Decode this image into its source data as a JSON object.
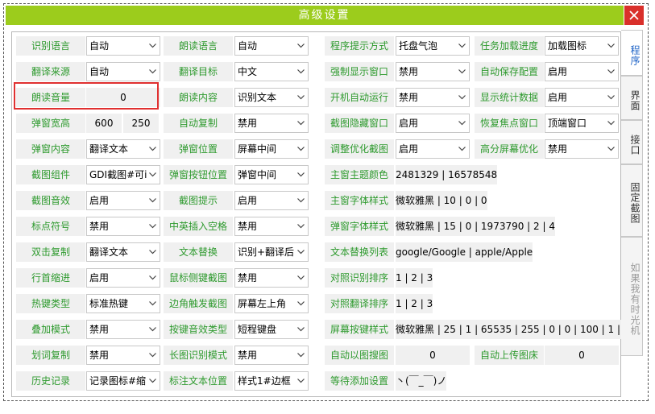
{
  "window": {
    "title": "高级设置"
  },
  "tabs": [
    {
      "label": "程序",
      "state": "active"
    },
    {
      "label": "界面",
      "state": "normal"
    },
    {
      "label": "接口",
      "state": "normal"
    },
    {
      "label": "固定截图",
      "state": "normal"
    },
    {
      "label": "如果我有时光机",
      "state": "dim"
    }
  ],
  "rows": [
    [
      [
        "l",
        "识别语言"
      ],
      [
        "d",
        "自动"
      ],
      [
        "l",
        "朗读语言"
      ],
      [
        "d",
        "自动"
      ],
      [
        "l",
        "程序提示方式"
      ],
      [
        "d",
        "托盘气泡"
      ],
      [
        "l",
        "任务加载进度"
      ],
      [
        "d",
        "加载图标"
      ]
    ],
    [
      [
        "l",
        "翻译来源"
      ],
      [
        "d",
        "自动"
      ],
      [
        "l",
        "翻译目标"
      ],
      [
        "d",
        "中文"
      ],
      [
        "l",
        "强制显示窗口"
      ],
      [
        "d",
        "禁用"
      ],
      [
        "l",
        "自动保存配置"
      ],
      [
        "d",
        "启用"
      ]
    ],
    [
      [
        "l",
        "朗读音量"
      ],
      [
        "v",
        "0"
      ],
      [
        "l",
        "朗读内容"
      ],
      [
        "d",
        "识别文本"
      ],
      [
        "l",
        "开机自动运行"
      ],
      [
        "d",
        "禁用"
      ],
      [
        "l",
        "显示统计数据"
      ],
      [
        "d",
        "启用"
      ]
    ],
    [
      [
        "l",
        "弹窗宽高"
      ],
      [
        "v",
        "600"
      ],
      [
        "v",
        "250"
      ],
      [
        "l",
        "自动复制"
      ],
      [
        "d",
        "禁用"
      ],
      [
        "l",
        "截图隐藏窗口"
      ],
      [
        "d",
        "启用"
      ],
      [
        "l",
        "恢复焦点窗口"
      ],
      [
        "d",
        "顶端窗口"
      ]
    ],
    [
      [
        "l",
        "弹窗内容"
      ],
      [
        "d",
        "翻译文本"
      ],
      [
        "l",
        "弹窗位置"
      ],
      [
        "d",
        "屏幕中间"
      ],
      [
        "l",
        "调整优化截图"
      ],
      [
        "d",
        "启用"
      ],
      [
        "l",
        "高分屏幕优化"
      ],
      [
        "d",
        "禁用"
      ]
    ],
    [
      [
        "l",
        "截图组件"
      ],
      [
        "d",
        "GDI截图#可i"
      ],
      [
        "l",
        "弹窗按钮位置"
      ],
      [
        "d",
        "弹窗中间"
      ],
      [
        "l",
        "主窗主题颜色"
      ],
      [
        "w",
        "2481329 | 16578548"
      ]
    ],
    [
      [
        "l",
        "截图音效"
      ],
      [
        "d",
        "启用"
      ],
      [
        "l",
        "截图提示"
      ],
      [
        "d",
        "启用"
      ],
      [
        "l",
        "主窗字体样式"
      ],
      [
        "w",
        "微软雅黑 | 10 | 0 | 0"
      ]
    ],
    [
      [
        "l",
        "标点符号"
      ],
      [
        "d",
        "禁用"
      ],
      [
        "l",
        "中英插入空格"
      ],
      [
        "d",
        "禁用"
      ],
      [
        "l",
        "弹窗字体样式"
      ],
      [
        "w",
        "微软雅黑 | 15 | 0 | 1973790 | 2 | 4"
      ]
    ],
    [
      [
        "l",
        "双击复制"
      ],
      [
        "d",
        "翻译文本"
      ],
      [
        "l",
        "文本替换"
      ],
      [
        "d",
        "识别+翻译后"
      ],
      [
        "l",
        "文本替换列表"
      ],
      [
        "w",
        "google/Google | apple/Apple"
      ]
    ],
    [
      [
        "l",
        "行首缩进"
      ],
      [
        "d",
        "启用"
      ],
      [
        "l",
        "鼠标侧键截图"
      ],
      [
        "d",
        "禁用"
      ],
      [
        "l",
        "对照识别排序"
      ],
      [
        "w",
        "1 | 2 | 3"
      ]
    ],
    [
      [
        "l",
        "热键类型"
      ],
      [
        "d",
        "标准热键"
      ],
      [
        "l",
        "边角触发截图"
      ],
      [
        "d",
        "屏幕左上角"
      ],
      [
        "l",
        "对照翻译排序"
      ],
      [
        "w",
        "1 | 2 | 3"
      ]
    ],
    [
      [
        "l",
        "叠加模式"
      ],
      [
        "d",
        "禁用"
      ],
      [
        "l",
        "按键音效类型"
      ],
      [
        "d",
        "短程键盘"
      ],
      [
        "l",
        "屏幕按键样式"
      ],
      [
        "w",
        "微软雅黑 | 25 | 1 | 65535 | 255 | 0 | 0 | 100 | 1 | 1"
      ]
    ],
    [
      [
        "l",
        "划词复制"
      ],
      [
        "d",
        "禁用"
      ],
      [
        "l",
        "长图识别模式"
      ],
      [
        "d",
        "禁用"
      ],
      [
        "l",
        "自动以图搜图"
      ],
      [
        "v",
        "0"
      ],
      [
        "l",
        "自动上传图床"
      ],
      [
        "v",
        "0"
      ]
    ],
    [
      [
        "l",
        "历史记录"
      ],
      [
        "d",
        "记录图标#缩"
      ],
      [
        "l",
        "标注文本位置"
      ],
      [
        "d",
        "样式1#边框"
      ],
      [
        "l",
        "等待添加设置"
      ],
      [
        "w",
        "丶(￣_￣)ノ"
      ]
    ]
  ]
}
